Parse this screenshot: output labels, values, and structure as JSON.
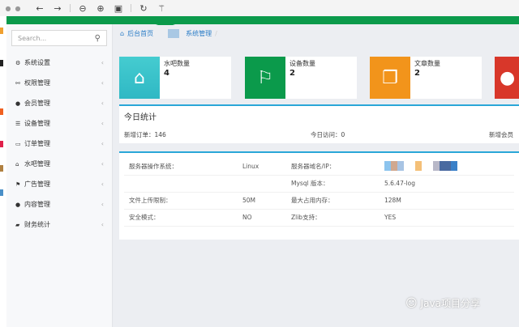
{
  "toolbar": {
    "icons": [
      "close-dot-icon",
      "minimize-dot-icon",
      "back-arrow-icon",
      "forward-arrow-icon",
      "zoom-out-icon",
      "zoom-in-icon",
      "fit-icon",
      "rotate-icon",
      "magic-wand-icon"
    ]
  },
  "colors": {
    "topbar": "#0b9a4b",
    "accent": "#2aa7d8",
    "card1": "#3fc7cc",
    "card2": "#0b9a4b",
    "card3": "#f2941b",
    "card4": "#d8372a"
  },
  "sidebar": {
    "search_placeholder": "Search...",
    "items": [
      {
        "label": "系统设置",
        "icon": "gear-icon"
      },
      {
        "label": "权限管理",
        "icon": "share-icon"
      },
      {
        "label": "会员管理",
        "icon": "user-icon"
      },
      {
        "label": "设备管理",
        "icon": "list-icon"
      },
      {
        "label": "订单管理",
        "icon": "order-icon"
      },
      {
        "label": "水吧管理",
        "icon": "home-icon"
      },
      {
        "label": "广告管理",
        "icon": "flag-icon"
      },
      {
        "label": "内容管理",
        "icon": "comments-icon"
      },
      {
        "label": "财务统计",
        "icon": "money-icon"
      }
    ]
  },
  "breadcrumb": {
    "home": "后台首页",
    "current": "系统管理",
    "sep": "/"
  },
  "cards": [
    {
      "title": "水吧数量",
      "value": "4",
      "icon": "home-icon"
    },
    {
      "title": "设备数量",
      "value": "2",
      "icon": "flag-icon"
    },
    {
      "title": "文章数量",
      "value": "2",
      "icon": "copy-icon"
    },
    {
      "title": "",
      "value": "",
      "icon": "user-icon"
    }
  ],
  "today": {
    "title": "今日统计",
    "new_orders": "新增订单：146",
    "visits": "今日访问：0",
    "new_members": "新增会员"
  },
  "server": {
    "rows": [
      [
        "服务器操作系统：",
        "Linux",
        "服务器域名/IP：",
        ""
      ],
      [
        "",
        "",
        "Mysql 版本：",
        "5.6.47-log"
      ],
      [
        "文件上传限制：",
        "50M",
        "最大占用内存：",
        "128M"
      ],
      [
        "安全模式：",
        "NO",
        "Zlib支持：",
        "YES"
      ]
    ]
  },
  "watermark": "Java项目分享"
}
